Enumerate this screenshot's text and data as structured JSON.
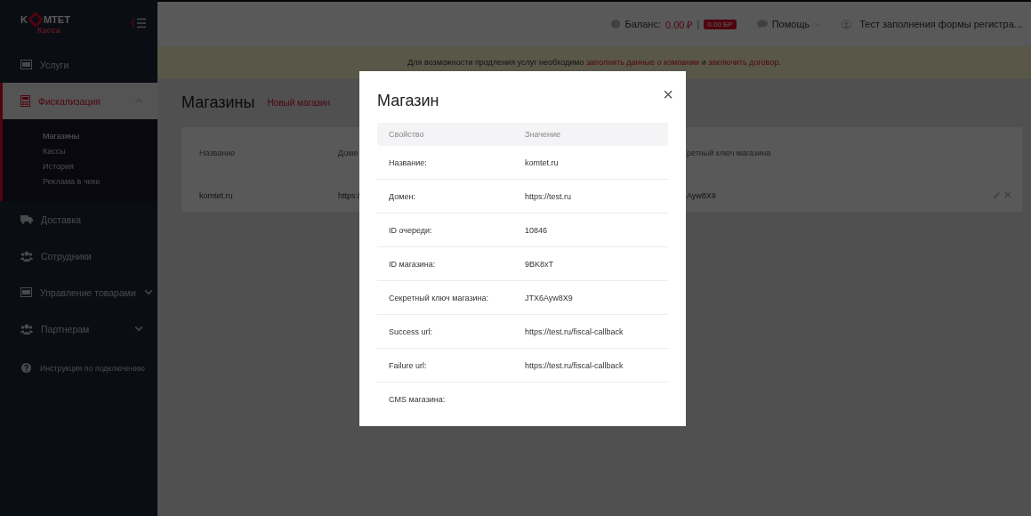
{
  "logo": {
    "brand_left": "K",
    "brand_right": "MTET",
    "subtitle": "Касса"
  },
  "sidebar": {
    "items": [
      {
        "label": "Услуги",
        "selected": false
      },
      {
        "label": "Фискализация",
        "selected": true,
        "expanded": true,
        "children": [
          {
            "label": "Магазины",
            "selected": true
          },
          {
            "label": "Кассы",
            "selected": false
          },
          {
            "label": "История",
            "selected": false
          },
          {
            "label": "Реклама в чеке",
            "selected": false
          }
        ]
      },
      {
        "label": "Доставка",
        "selected": false
      },
      {
        "label": "Сотрудники",
        "selected": false
      },
      {
        "label": "Управление товарами",
        "selected": false,
        "expanded": false
      },
      {
        "label": "Партнерам",
        "selected": false,
        "expanded": false
      }
    ],
    "help_link": "Инструкция по подключению"
  },
  "header": {
    "balance_label": "Баланс:",
    "balance_value": "0.00 ₽",
    "separator": "|",
    "bonus_badge": "0.00 БР",
    "help_menu": "Помощь",
    "user_name": "Тест заполнения формы регистра..."
  },
  "notice": {
    "before": "Для возможности продления услуг необходимо ",
    "link_1": "заполнить данные о компании",
    "middle": " и ",
    "link_2": "заключить договор",
    "after": "."
  },
  "page": {
    "title": "Магазины",
    "new_button": "Новый магазин",
    "table": {
      "columns": [
        "Название",
        "Доме",
        "ретный ключ магазина"
      ],
      "rows": [
        {
          "cells": [
            "komtet.ru",
            "https:/",
            "Ayw8X9"
          ]
        }
      ]
    }
  },
  "modal": {
    "title": "Магазин",
    "close": "×",
    "columns": [
      "Свойство",
      "Значение"
    ],
    "rows": [
      {
        "property": "Название:",
        "value": "komtet.ru"
      },
      {
        "property": "Домен:",
        "value": "https://test.ru"
      },
      {
        "property": "ID очереди:",
        "value": "10846"
      },
      {
        "property": "ID магазина:",
        "value": "9BK8xT"
      },
      {
        "property": "Секретный ключ магазина:",
        "value": "JTX6Ayw8X9"
      },
      {
        "property": "Success url:",
        "value": "https://test.ru/fiscal-callback"
      },
      {
        "property": "Failure url:",
        "value": "https://test.ru/fiscal-callback"
      },
      {
        "property": "CMS магазина:",
        "value": ""
      }
    ]
  }
}
